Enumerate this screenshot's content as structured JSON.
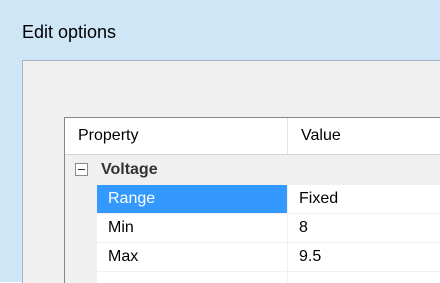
{
  "dialog": {
    "title": "Edit options"
  },
  "grid": {
    "headers": {
      "property": "Property",
      "value": "Value"
    },
    "category": {
      "label": "Voltage",
      "expanded": true
    },
    "rows": [
      {
        "name": "Range",
        "value": "Fixed",
        "selected": true
      },
      {
        "name": "Min",
        "value": "8",
        "selected": false
      },
      {
        "name": "Max",
        "value": "9.5",
        "selected": false
      }
    ]
  },
  "colors": {
    "selection": "#3399ff",
    "titlebar": "#cfe6f7",
    "gutter": "#f0f0f0"
  },
  "icons": {
    "category_toggle": "collapse-minus-icon"
  }
}
